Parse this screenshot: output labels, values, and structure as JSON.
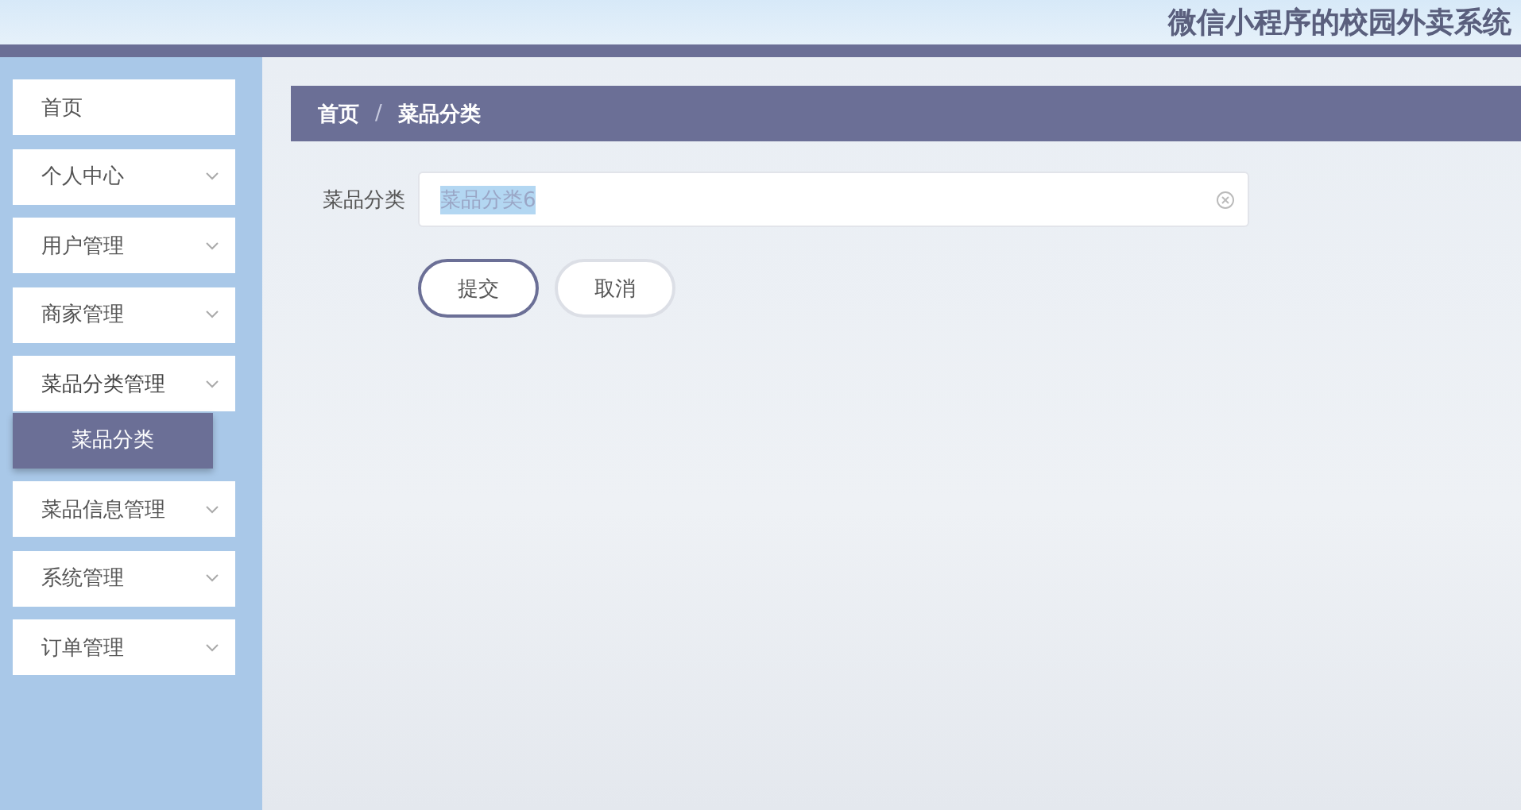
{
  "header": {
    "title": "微信小程序的校园外卖系统"
  },
  "sidebar": {
    "items": [
      {
        "label": "首页",
        "kind": "link",
        "expanded": false
      },
      {
        "label": "个人中心",
        "kind": "submenu",
        "expanded": false
      },
      {
        "label": "用户管理",
        "kind": "submenu",
        "expanded": false
      },
      {
        "label": "商家管理",
        "kind": "submenu",
        "expanded": false
      },
      {
        "label": "菜品分类管理",
        "kind": "submenu",
        "expanded": true,
        "children": [
          {
            "label": "菜品分类",
            "selected": true
          }
        ]
      },
      {
        "label": "菜品信息管理",
        "kind": "submenu",
        "expanded": false
      },
      {
        "label": "系统管理",
        "kind": "submenu",
        "expanded": false
      },
      {
        "label": "订单管理",
        "kind": "submenu",
        "expanded": false
      }
    ]
  },
  "breadcrumb": {
    "separator": "/",
    "items": [
      "首页",
      "菜品分类"
    ]
  },
  "form": {
    "fields": [
      {
        "label": "菜品分类",
        "value": "菜品分类6"
      }
    ],
    "buttons": [
      {
        "label": "提交",
        "kind": "primary"
      },
      {
        "label": "取消",
        "kind": "secondary"
      }
    ]
  }
}
